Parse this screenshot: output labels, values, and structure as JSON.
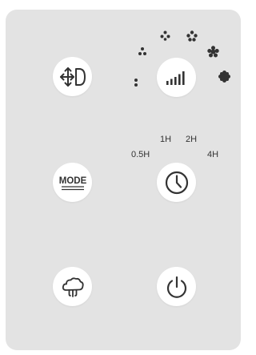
{
  "panel": {
    "background": "#e3e3e3",
    "button_background": "#ffffff",
    "icon_color": "#333333"
  },
  "buttons": [
    {
      "name": "swing-button",
      "icon": "oscillation-arrows-icon"
    },
    {
      "name": "speed-button",
      "icon": "signal-bars-icon"
    },
    {
      "name": "mode-button",
      "icon": "mode-text-icon",
      "label": "MODE"
    },
    {
      "name": "timer-button",
      "icon": "clock-icon"
    },
    {
      "name": "steam-button",
      "icon": "steam-cloud-icon"
    },
    {
      "name": "power-button",
      "icon": "power-icon"
    }
  ],
  "speed_indicators": {
    "levels": [
      "level-1",
      "level-2",
      "level-3",
      "level-4",
      "level-5",
      "level-6"
    ]
  },
  "timer_labels": {
    "half_hour": "0.5H",
    "one_hour": "1H",
    "two_hours": "2H",
    "four_hours": "4H"
  },
  "mode": {
    "label": "MODE"
  }
}
